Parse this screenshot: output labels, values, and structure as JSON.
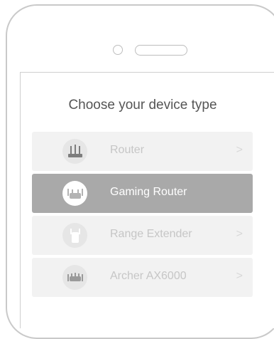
{
  "screen": {
    "title": "Choose your device type"
  },
  "devices": [
    {
      "label": "Router",
      "icon": "router-icon",
      "selected": false,
      "chevron": ">"
    },
    {
      "label": "Gaming Router",
      "icon": "gaming-router-icon",
      "selected": true,
      "chevron": ">"
    },
    {
      "label": "Range Extender",
      "icon": "range-extender-icon",
      "selected": false,
      "chevron": ">"
    },
    {
      "label": "Archer AX6000",
      "icon": "archer-router-icon",
      "selected": false,
      "chevron": ">"
    }
  ],
  "colors": {
    "selected_bg": "#a9a9a9",
    "item_bg": "#f2f2f2",
    "item_text": "#c6c6c6"
  }
}
